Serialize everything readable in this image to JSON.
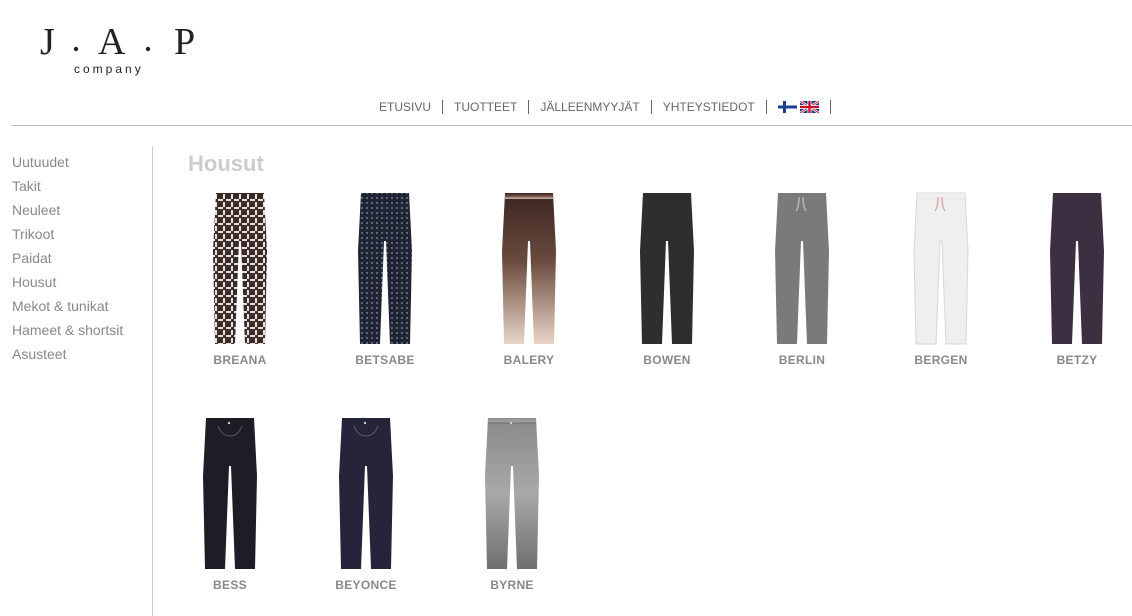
{
  "logo": {
    "main": "J.A.P",
    "sub": "company"
  },
  "nav": {
    "items": [
      "ETUSIVU",
      "TUOTTEET",
      "JÄLLEENMYYJÄT",
      "YHTEYSTIEDOT"
    ]
  },
  "sidebar": {
    "items": [
      "Uutuudet",
      "Takit",
      "Neuleet",
      "Trikoot",
      "Paidat",
      "Housut",
      "Mekot & tunikat",
      "Hameet & shortsit",
      "Asusteet"
    ]
  },
  "page": {
    "title": "Housut"
  },
  "products": [
    {
      "name": "BREANA",
      "color": "#3a2a28",
      "style": "pattern-check"
    },
    {
      "name": "BETSABE",
      "color": "#1f2433",
      "style": "pattern-dots"
    },
    {
      "name": "BALERY",
      "color": "#4a2e26",
      "style": "gradient-light"
    },
    {
      "name": "BOWEN",
      "color": "#2e2e30",
      "style": "solid"
    },
    {
      "name": "BERLIN",
      "color": "#7a7a7c",
      "style": "drawstring"
    },
    {
      "name": "BERGEN",
      "color": "#efefed",
      "style": "drawstring-cuff"
    },
    {
      "name": "BETZY",
      "color": "#3d2f42",
      "style": "solid"
    },
    {
      "name": "BESS",
      "color": "#1c1d26",
      "style": "jeans"
    },
    {
      "name": "BEYONCE",
      "color": "#25243a",
      "style": "jeans"
    },
    {
      "name": "BYRNE",
      "color": "#8a898b",
      "style": "jeans-faded"
    }
  ]
}
